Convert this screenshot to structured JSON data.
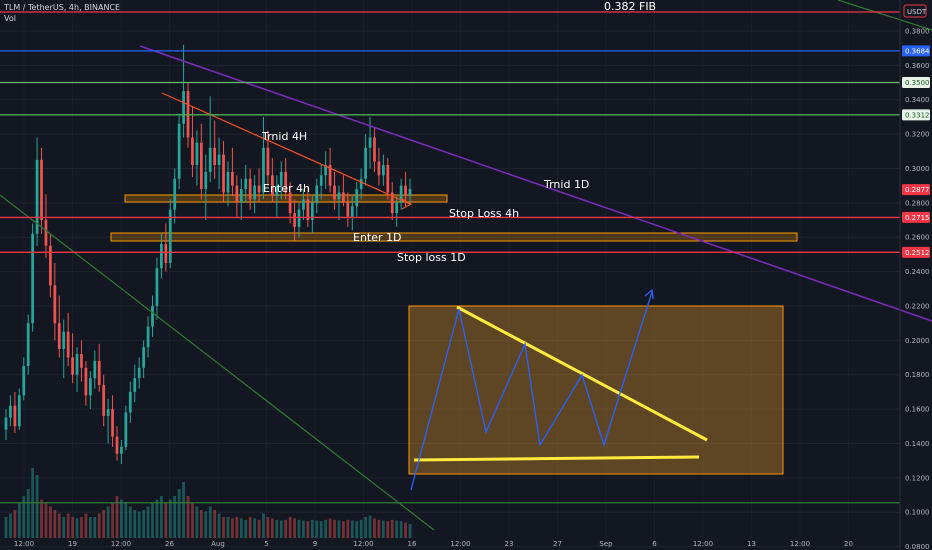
{
  "header": {
    "symbol": "TLM / TetherUS, 4h, BINANCE",
    "volume_label": "Vol",
    "currency": "USDT"
  },
  "chart_data": {
    "type": "candlestick",
    "ylim": [
      0.078,
      0.398
    ],
    "y_ticks": [
      {
        "label": "0.3800",
        "value": 0.38
      },
      {
        "label": "0.3600",
        "value": 0.36
      },
      {
        "label": "0.3400",
        "value": 0.34
      },
      {
        "label": "0.3200",
        "value": 0.32
      },
      {
        "label": "0.3000",
        "value": 0.3
      },
      {
        "label": "0.2800",
        "value": 0.28
      },
      {
        "label": "0.2600",
        "value": 0.26
      },
      {
        "label": "0.2400",
        "value": 0.24
      },
      {
        "label": "0.2200",
        "value": 0.22
      },
      {
        "label": "0.2000",
        "value": 0.2
      },
      {
        "label": "0.1800",
        "value": 0.18
      },
      {
        "label": "0.1600",
        "value": 0.16
      },
      {
        "label": "0.1400",
        "value": 0.14
      },
      {
        "label": "0.1200",
        "value": 0.12
      },
      {
        "label": "0.1000",
        "value": 0.1
      },
      {
        "label": "0.0800",
        "value": 0.08
      }
    ],
    "x_ticks": [
      "12:00",
      "19",
      "12:00",
      "26",
      "Aug",
      "5",
      "9",
      "12:00",
      "16",
      "12:00",
      "23",
      "27",
      "Sep",
      "6",
      "12:00",
      "13",
      "12:00",
      "20"
    ],
    "price_tags": [
      {
        "label": "0.3684",
        "value": 0.3684,
        "bg": "#2962ff",
        "fg": "#ffffff"
      },
      {
        "label": "0.3500",
        "value": 0.35,
        "bg": "#e8f5e9",
        "fg": "#1b5e20"
      },
      {
        "label": "0.3312",
        "value": 0.3312,
        "bg": "#e8f5e9",
        "fg": "#1b5e20"
      },
      {
        "label": "0.2877",
        "value": 0.2877,
        "bg": "#f23645",
        "fg": "#ffffff"
      },
      {
        "label": "0.2715",
        "value": 0.2715,
        "bg": "#f23645",
        "fg": "#ffffff"
      },
      {
        "label": "0.2512",
        "value": 0.2512,
        "bg": "#f23645",
        "fg": "#ffffff"
      }
    ],
    "horizontal_levels": [
      {
        "value": 0.3684,
        "color": "#2962ff"
      },
      {
        "value": 0.35,
        "color": "#66bb6a"
      },
      {
        "value": 0.3312,
        "color": "#4caf50"
      },
      {
        "value": 0.2715,
        "color": "#f23645"
      },
      {
        "value": 0.2512,
        "color": "#f23645"
      },
      {
        "value": 0.1055,
        "color": "#2e7d32"
      }
    ],
    "annotations": {
      "fib": "0.382 FIB",
      "trend_4h": "Trnid 4H",
      "trend_1d": "Trnid 1D",
      "enter_4h": "Enter 4h",
      "stop_4h": "Stop Loss 4h",
      "enter_1d": "Enter 1D",
      "stop_1d": "Stop loss 1D"
    },
    "candles": [
      [
        0.148,
        0.16,
        0.142,
        0.155
      ],
      [
        0.155,
        0.168,
        0.15,
        0.162
      ],
      [
        0.162,
        0.17,
        0.146,
        0.15
      ],
      [
        0.15,
        0.172,
        0.148,
        0.168
      ],
      [
        0.168,
        0.19,
        0.165,
        0.185
      ],
      [
        0.185,
        0.215,
        0.18,
        0.21
      ],
      [
        0.21,
        0.268,
        0.205,
        0.262
      ],
      [
        0.262,
        0.318,
        0.255,
        0.305
      ],
      [
        0.305,
        0.312,
        0.262,
        0.27
      ],
      [
        0.27,
        0.285,
        0.248,
        0.255
      ],
      [
        0.255,
        0.262,
        0.225,
        0.232
      ],
      [
        0.232,
        0.245,
        0.2,
        0.21
      ],
      [
        0.21,
        0.226,
        0.19,
        0.195
      ],
      [
        0.195,
        0.212,
        0.178,
        0.205
      ],
      [
        0.205,
        0.216,
        0.185,
        0.19
      ],
      [
        0.19,
        0.204,
        0.175,
        0.18
      ],
      [
        0.18,
        0.196,
        0.17,
        0.192
      ],
      [
        0.192,
        0.2,
        0.176,
        0.184
      ],
      [
        0.184,
        0.188,
        0.162,
        0.168
      ],
      [
        0.168,
        0.182,
        0.16,
        0.178
      ],
      [
        0.178,
        0.194,
        0.172,
        0.188
      ],
      [
        0.188,
        0.198,
        0.17,
        0.174
      ],
      [
        0.174,
        0.18,
        0.15,
        0.156
      ],
      [
        0.156,
        0.166,
        0.14,
        0.16
      ],
      [
        0.16,
        0.168,
        0.138,
        0.144
      ],
      [
        0.144,
        0.15,
        0.13,
        0.134
      ],
      [
        0.134,
        0.142,
        0.128,
        0.138
      ],
      [
        0.138,
        0.162,
        0.136,
        0.158
      ],
      [
        0.158,
        0.176,
        0.152,
        0.17
      ],
      [
        0.17,
        0.186,
        0.164,
        0.178
      ],
      [
        0.178,
        0.19,
        0.172,
        0.184
      ],
      [
        0.184,
        0.2,
        0.178,
        0.196
      ],
      [
        0.196,
        0.214,
        0.19,
        0.208
      ],
      [
        0.208,
        0.226,
        0.202,
        0.22
      ],
      [
        0.22,
        0.248,
        0.212,
        0.242
      ],
      [
        0.242,
        0.262,
        0.236,
        0.256
      ],
      [
        0.256,
        0.268,
        0.24,
        0.245
      ],
      [
        0.245,
        0.282,
        0.242,
        0.276
      ],
      [
        0.276,
        0.3,
        0.268,
        0.294
      ],
      [
        0.294,
        0.332,
        0.288,
        0.326
      ],
      [
        0.326,
        0.372,
        0.318,
        0.345
      ],
      [
        0.345,
        0.35,
        0.312,
        0.318
      ],
      [
        0.318,
        0.336,
        0.295,
        0.302
      ],
      [
        0.302,
        0.322,
        0.29,
        0.315
      ],
      [
        0.315,
        0.326,
        0.282,
        0.288
      ],
      [
        0.288,
        0.308,
        0.27,
        0.298
      ],
      [
        0.298,
        0.342,
        0.292,
        0.312
      ],
      [
        0.312,
        0.328,
        0.294,
        0.302
      ],
      [
        0.302,
        0.318,
        0.288,
        0.308
      ],
      [
        0.308,
        0.316,
        0.28,
        0.286
      ],
      [
        0.286,
        0.304,
        0.278,
        0.298
      ],
      [
        0.298,
        0.312,
        0.284,
        0.29
      ],
      [
        0.29,
        0.296,
        0.272,
        0.28
      ],
      [
        0.28,
        0.294,
        0.27,
        0.288
      ],
      [
        0.288,
        0.302,
        0.28,
        0.294
      ],
      [
        0.294,
        0.3,
        0.276,
        0.282
      ],
      [
        0.282,
        0.296,
        0.274,
        0.29
      ],
      [
        0.29,
        0.3,
        0.28,
        0.286
      ],
      [
        0.286,
        0.33,
        0.282,
        0.312
      ],
      [
        0.312,
        0.322,
        0.29,
        0.296
      ],
      [
        0.296,
        0.306,
        0.28,
        0.284
      ],
      [
        0.284,
        0.296,
        0.272,
        0.29
      ],
      [
        0.29,
        0.304,
        0.282,
        0.298
      ],
      [
        0.298,
        0.306,
        0.282,
        0.286
      ],
      [
        0.286,
        0.292,
        0.268,
        0.274
      ],
      [
        0.274,
        0.282,
        0.258,
        0.266
      ],
      [
        0.266,
        0.28,
        0.26,
        0.276
      ],
      [
        0.276,
        0.288,
        0.27,
        0.282
      ],
      [
        0.282,
        0.29,
        0.266,
        0.27
      ],
      [
        0.27,
        0.284,
        0.262,
        0.28
      ],
      [
        0.28,
        0.294,
        0.274,
        0.29
      ],
      [
        0.29,
        0.302,
        0.282,
        0.296
      ],
      [
        0.296,
        0.31,
        0.288,
        0.302
      ],
      [
        0.302,
        0.312,
        0.286,
        0.29
      ],
      [
        0.29,
        0.298,
        0.276,
        0.282
      ],
      [
        0.282,
        0.29,
        0.27,
        0.286
      ],
      [
        0.286,
        0.296,
        0.278,
        0.28
      ],
      [
        0.28,
        0.286,
        0.266,
        0.272
      ],
      [
        0.272,
        0.284,
        0.264,
        0.278
      ],
      [
        0.278,
        0.292,
        0.272,
        0.288
      ],
      [
        0.288,
        0.3,
        0.282,
        0.294
      ],
      [
        0.294,
        0.32,
        0.29,
        0.312
      ],
      [
        0.312,
        0.33,
        0.3,
        0.318
      ],
      [
        0.318,
        0.324,
        0.298,
        0.304
      ],
      [
        0.304,
        0.312,
        0.29,
        0.296
      ],
      [
        0.296,
        0.308,
        0.29,
        0.302
      ],
      [
        0.302,
        0.306,
        0.282,
        0.286
      ],
      [
        0.286,
        0.292,
        0.27,
        0.274
      ],
      [
        0.274,
        0.284,
        0.266,
        0.28
      ],
      [
        0.28,
        0.294,
        0.276,
        0.29
      ],
      [
        0.29,
        0.298,
        0.278,
        0.284
      ],
      [
        0.284,
        0.294,
        0.28,
        0.288
      ]
    ],
    "volumes": [
      0.3,
      0.35,
      0.4,
      0.5,
      0.6,
      0.7,
      1.0,
      0.9,
      0.55,
      0.5,
      0.45,
      0.4,
      0.35,
      0.3,
      0.35,
      0.3,
      0.28,
      0.3,
      0.35,
      0.3,
      0.3,
      0.35,
      0.4,
      0.45,
      0.5,
      0.6,
      0.55,
      0.5,
      0.45,
      0.4,
      0.38,
      0.4,
      0.45,
      0.5,
      0.55,
      0.6,
      0.5,
      0.55,
      0.6,
      0.7,
      0.8,
      0.6,
      0.5,
      0.45,
      0.4,
      0.38,
      0.45,
      0.4,
      0.35,
      0.3,
      0.3,
      0.28,
      0.3,
      0.28,
      0.26,
      0.3,
      0.28,
      0.26,
      0.35,
      0.3,
      0.28,
      0.26,
      0.25,
      0.26,
      0.3,
      0.28,
      0.26,
      0.25,
      0.24,
      0.26,
      0.25,
      0.24,
      0.26,
      0.28,
      0.26,
      0.25,
      0.24,
      0.26,
      0.25,
      0.24,
      0.26,
      0.3,
      0.32,
      0.28,
      0.26,
      0.25,
      0.24,
      0.26,
      0.25,
      0.24,
      0.22,
      0.2
    ]
  }
}
